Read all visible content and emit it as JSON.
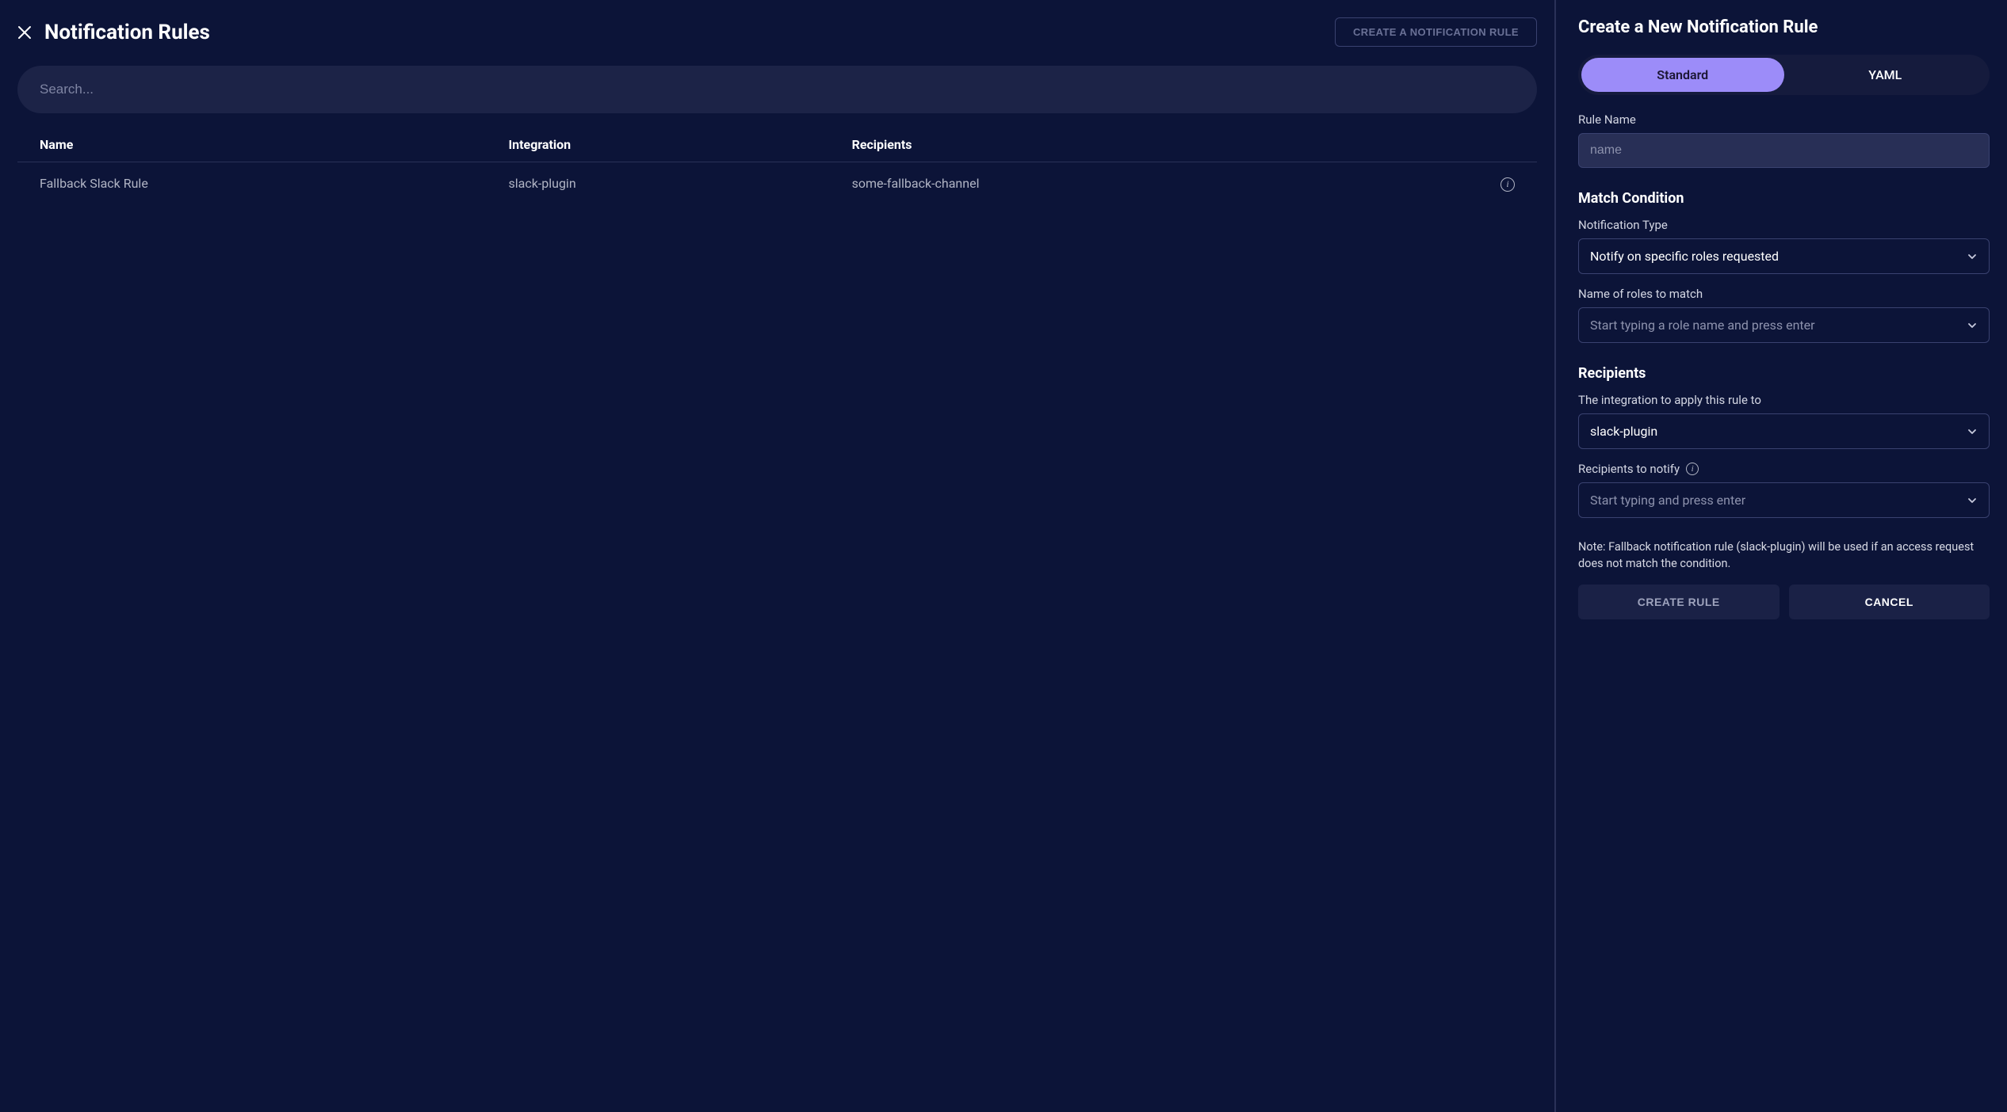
{
  "left": {
    "title": "Notification Rules",
    "create_btn": "CREATE A NOTIFICATION RULE",
    "search_placeholder": "Search...",
    "columns": {
      "name": "Name",
      "integration": "Integration",
      "recipients": "Recipients"
    },
    "rows": [
      {
        "name": "Fallback Slack Rule",
        "integration": "slack-plugin",
        "recipients": "some-fallback-channel"
      }
    ]
  },
  "right": {
    "title": "Create a New Notification Rule",
    "tabs": {
      "standard": "Standard",
      "yaml": "YAML"
    },
    "rule_name_label": "Rule Name",
    "rule_name_placeholder": "name",
    "match_heading": "Match Condition",
    "notification_type_label": "Notification Type",
    "notification_type_value": "Notify on specific roles requested",
    "roles_label": "Name of roles to match",
    "roles_placeholder": "Start typing a role name and press enter",
    "recipients_heading": "Recipients",
    "integration_label": "The integration to apply this rule to",
    "integration_value": "slack-plugin",
    "recipients_label": "Recipients to notify",
    "recipients_placeholder": "Start typing and press enter",
    "note": "Note: Fallback notification rule (slack-plugin) will be used if an access request does not match the condition.",
    "create_btn": "CREATE RULE",
    "cancel_btn": "CANCEL"
  }
}
